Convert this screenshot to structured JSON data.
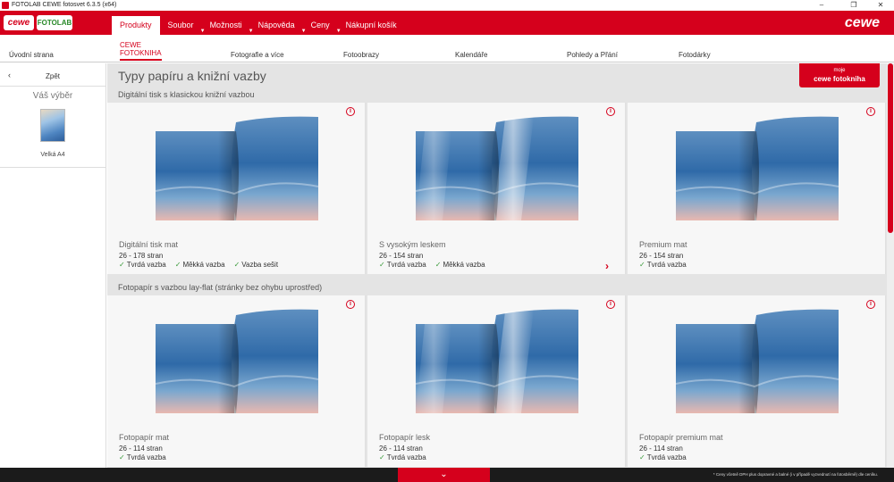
{
  "window": {
    "title": "FOTOLAB CEWE fotosvet 6.3.5 (x64)",
    "minimize": "–",
    "maximize": "❐",
    "close": "✕"
  },
  "header": {
    "logo_cewe": "cewe",
    "logo_fotolab": "FOTOLAB",
    "brand": "cewe",
    "menu": [
      {
        "label": "Produkty"
      },
      {
        "label": "Soubor"
      },
      {
        "label": "Možnosti"
      },
      {
        "label": "Nápověda"
      },
      {
        "label": "Ceny"
      },
      {
        "label": "Nákupní košík"
      }
    ]
  },
  "categories": [
    {
      "label": "Úvodní strana"
    },
    {
      "label": "CEWE\nFOTOKNIHA"
    },
    {
      "label": "Fotografie a více"
    },
    {
      "label": "Fotoobrazy"
    },
    {
      "label": "Kalendáře"
    },
    {
      "label": "Pohledy a Přání"
    },
    {
      "label": "Fotodárky"
    }
  ],
  "sidebar": {
    "back_icon": "‹",
    "back_label": "Zpět",
    "selection_title": "Váš výběr",
    "product_label": "Velká A4"
  },
  "main": {
    "title": "Typy papíru a knižní vazby",
    "moje_line1": "moje",
    "moje_line2": "cewe fotokniha",
    "info_glyph": "i",
    "check_glyph": "✓",
    "arrow_glyph": "›",
    "sections": [
      {
        "title": "Digitální tisk s klasickou knižní vazbou",
        "cards": [
          {
            "name": "Digitální tisk mat",
            "pages": "26 - 178 stran",
            "bindings": [
              "Tvrdá vazba",
              "Měkká vazba",
              "Vazba sešit"
            ],
            "glossy": false
          },
          {
            "name": "S vysokým leskem",
            "pages": "26 - 154 stran",
            "bindings": [
              "Tvrdá vazba",
              "Měkká vazba"
            ],
            "glossy": true
          },
          {
            "name": "Premium mat",
            "pages": "26 - 154 stran",
            "bindings": [
              "Tvrdá vazba"
            ],
            "glossy": false
          }
        ]
      },
      {
        "title": "Fotopapír s vazbou lay-flat (stránky bez ohybu uprostřed)",
        "cards": [
          {
            "name": "Fotopapír mat",
            "pages": "26 - 114 stran",
            "bindings": [
              "Tvrdá vazba"
            ],
            "glossy": false
          },
          {
            "name": "Fotopapír lesk",
            "pages": "26 - 114 stran",
            "bindings": [
              "Tvrdá vazba"
            ],
            "glossy": true
          },
          {
            "name": "Fotopapír premium mat",
            "pages": "26 - 114 stran",
            "bindings": [
              "Tvrdá vazba"
            ],
            "glossy": false
          }
        ]
      }
    ]
  },
  "footer": {
    "expand_icon": "⌄",
    "note": "* Ceny včetně DPH plus dopravné a balné (i v případě vyzvednutí na fotosběrně) dle ceníku."
  },
  "colors": {
    "brand_red": "#d5001c",
    "check_green": "#3a9a3a"
  }
}
